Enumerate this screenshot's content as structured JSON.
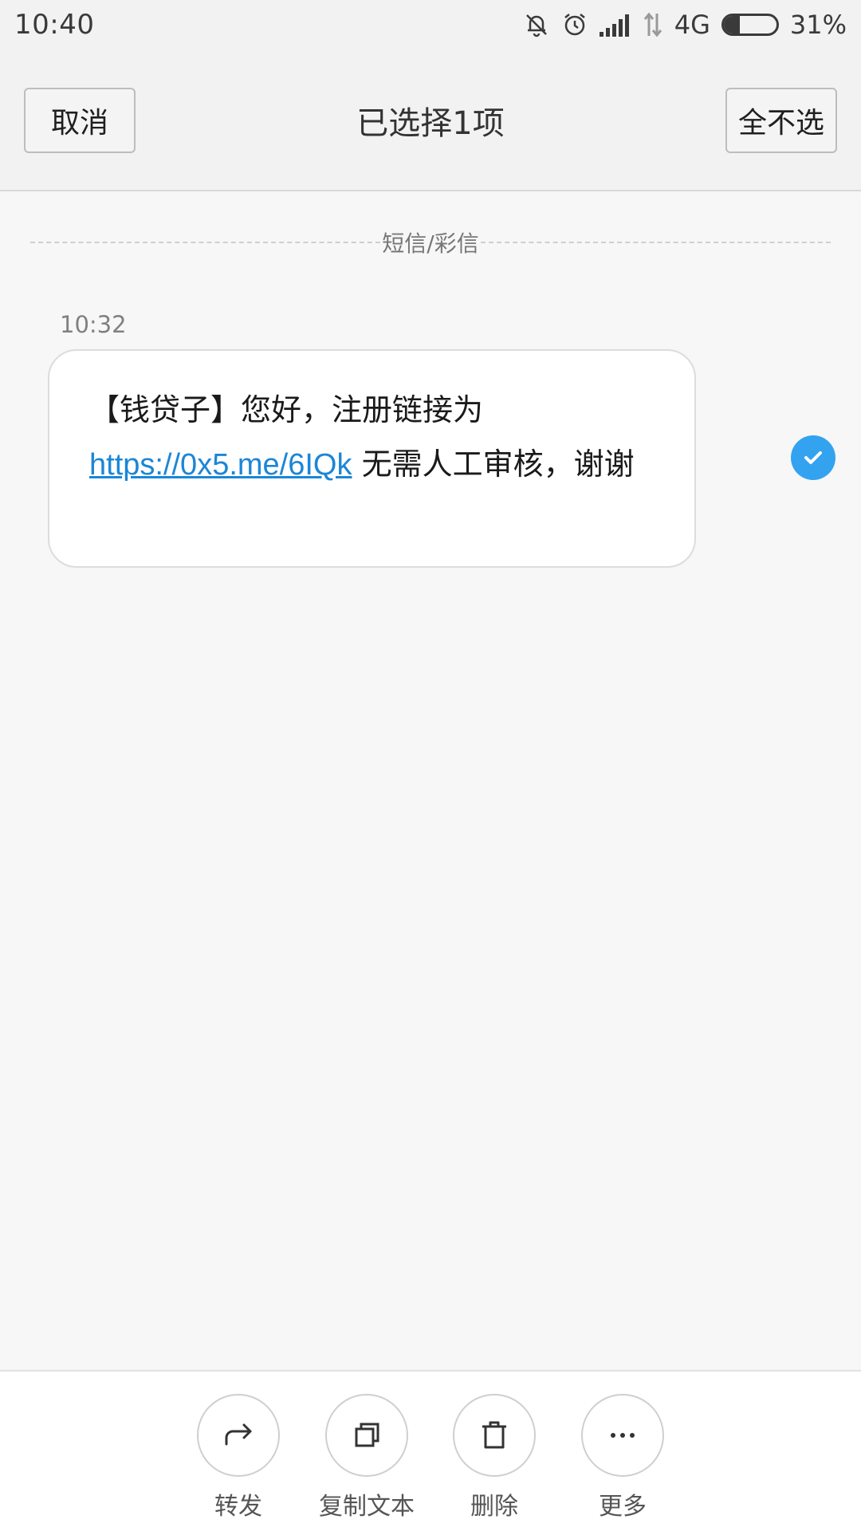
{
  "status_bar": {
    "time": "10:40",
    "network": "4G",
    "battery_text": "31%",
    "battery_level": 0.31,
    "icons": [
      "bell-off-icon",
      "alarm-icon",
      "signal-icon",
      "data-arrows-icon",
      "battery-icon"
    ]
  },
  "header": {
    "cancel_label": "取消",
    "title": "已选择1项",
    "deselect_all_label": "全不选"
  },
  "section": {
    "label": "短信/彩信"
  },
  "message": {
    "time": "10:32",
    "text_prefix": "【钱贷子】您好，注册链接为",
    "link": "https://0x5.me/6IQk",
    "text_suffix": " 无需人工审核，谢谢",
    "selected": true
  },
  "actions": [
    {
      "label": "转发",
      "icon": "forward-icon"
    },
    {
      "label": "复制文本",
      "icon": "copy-icon"
    },
    {
      "label": "删除",
      "icon": "trash-icon"
    },
    {
      "label": "更多",
      "icon": "more-icon"
    }
  ],
  "colors": {
    "accent": "#33a3f0",
    "link": "#1b86d6",
    "background": "#f7f7f7"
  }
}
